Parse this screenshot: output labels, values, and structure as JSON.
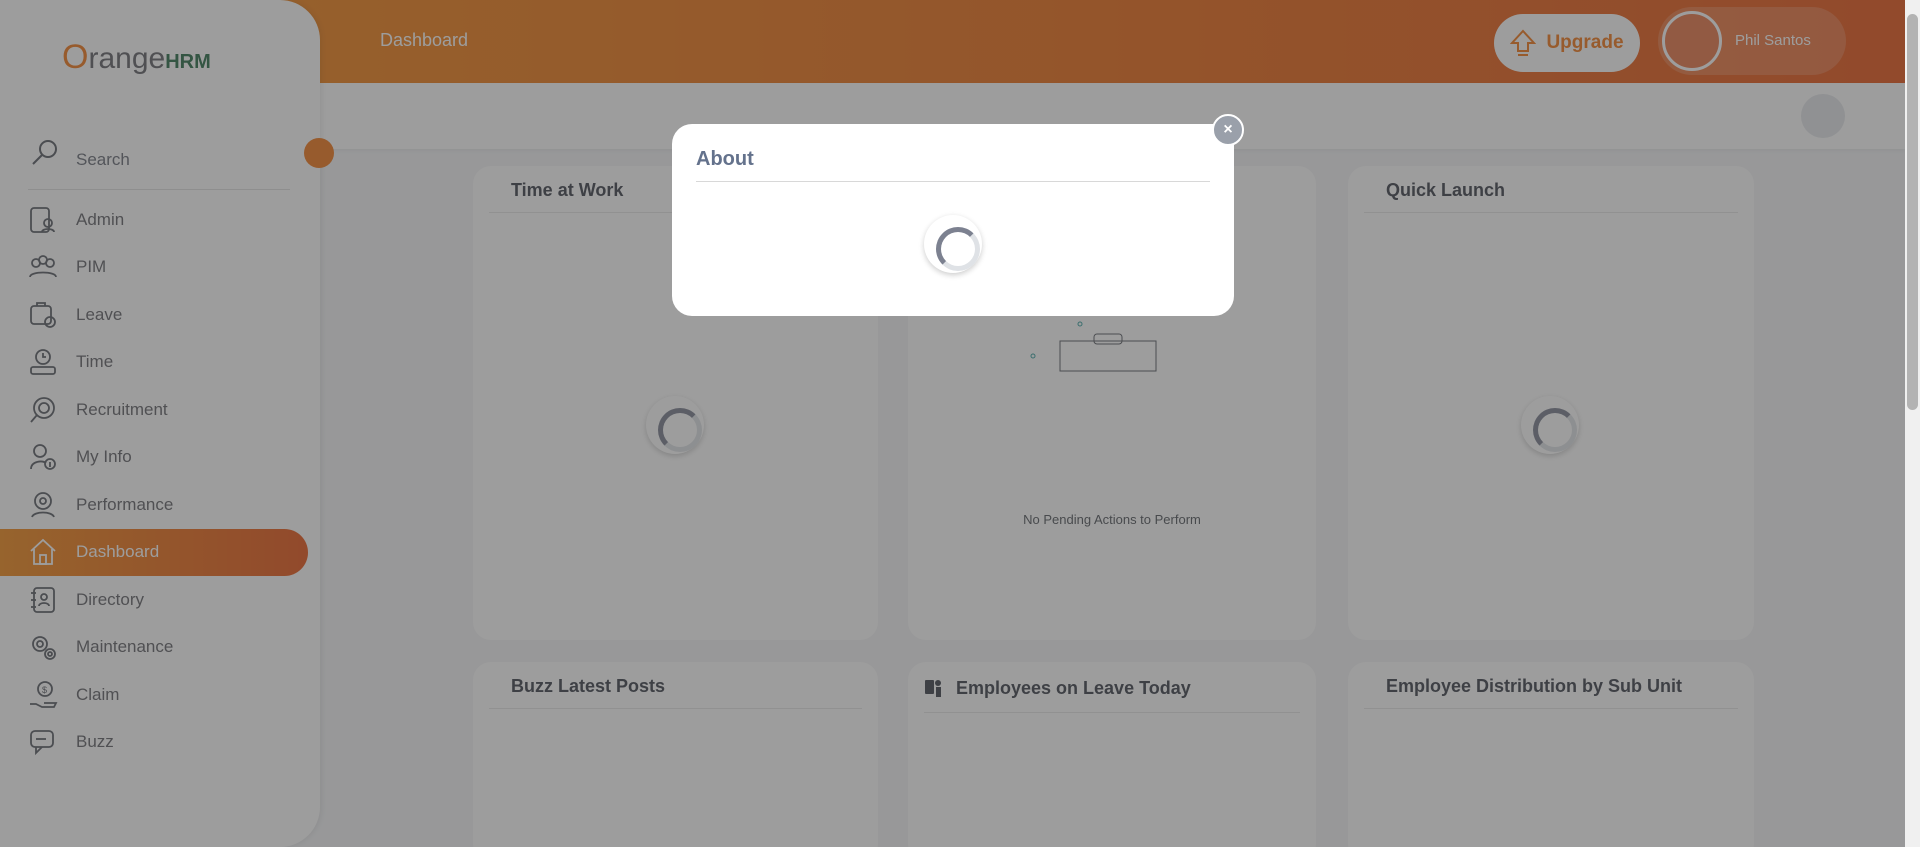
{
  "header": {
    "title": "Dashboard",
    "upgrade_label": "Upgrade",
    "user_name": "Phil Santos"
  },
  "logo": {
    "brand_main": "range",
    "brand_o": "O",
    "brand_hrm": "HRM"
  },
  "sidebar": {
    "search_label": "Search",
    "items": [
      {
        "label": "Admin",
        "icon": "admin-icon"
      },
      {
        "label": "PIM",
        "icon": "pim-icon"
      },
      {
        "label": "Leave",
        "icon": "leave-icon"
      },
      {
        "label": "Time",
        "icon": "time-icon"
      },
      {
        "label": "Recruitment",
        "icon": "recruitment-icon"
      },
      {
        "label": "My Info",
        "icon": "my-info-icon"
      },
      {
        "label": "Performance",
        "icon": "performance-icon"
      },
      {
        "label": "Dashboard",
        "icon": "home-icon",
        "active": true
      },
      {
        "label": "Directory",
        "icon": "directory-icon"
      },
      {
        "label": "Maintenance",
        "icon": "maintenance-icon"
      },
      {
        "label": "Claim",
        "icon": "claim-icon"
      },
      {
        "label": "Buzz",
        "icon": "buzz-icon"
      }
    ]
  },
  "cards": {
    "time_at_work": "Time at Work",
    "my_actions_empty": "No Pending Actions to Perform",
    "quick_launch": "Quick Launch",
    "buzz_latest_posts": "Buzz Latest Posts",
    "employees_on_leave": "Employees on Leave Today",
    "employee_distribution": "Employee Distribution by Sub Unit"
  },
  "modal": {
    "title": "About",
    "close_label": "×"
  },
  "colors": {
    "accent": "#F27A1E",
    "accent_dark": "#E8581C"
  }
}
